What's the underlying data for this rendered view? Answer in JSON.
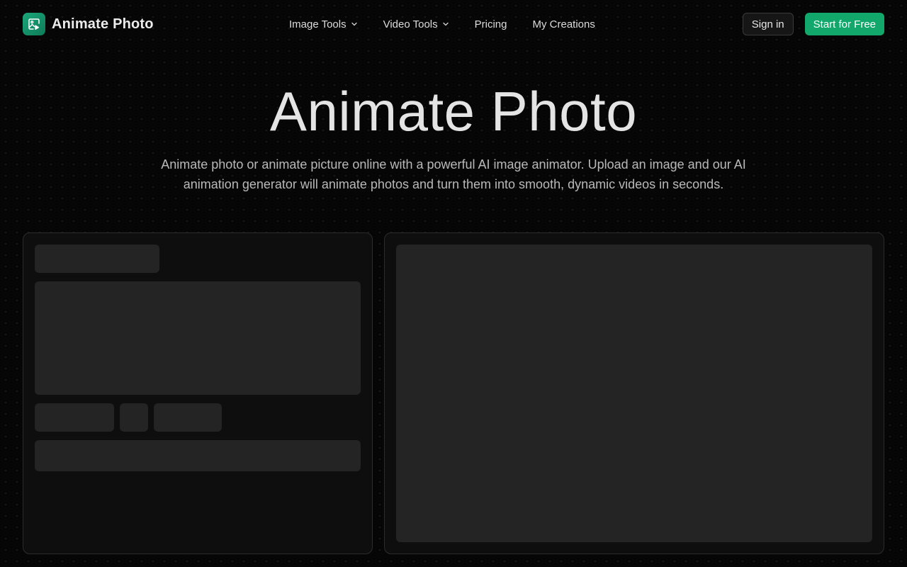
{
  "brand": {
    "name": "Animate Photo",
    "logo_icon": "image-play-icon",
    "accent_color": "#12a86b"
  },
  "nav": {
    "items": [
      {
        "label": "Image Tools",
        "has_dropdown": true
      },
      {
        "label": "Video Tools",
        "has_dropdown": true
      },
      {
        "label": "Pricing",
        "has_dropdown": false
      },
      {
        "label": "My Creations",
        "has_dropdown": false
      }
    ]
  },
  "actions": {
    "sign_in": "Sign in",
    "start_free": "Start for Free"
  },
  "hero": {
    "title": "Animate Photo",
    "subtitle": "Animate photo or animate picture online with a powerful AI image animator. Upload an image and our AI animation generator will animate photos and turn them into smooth, dynamic videos in seconds."
  }
}
